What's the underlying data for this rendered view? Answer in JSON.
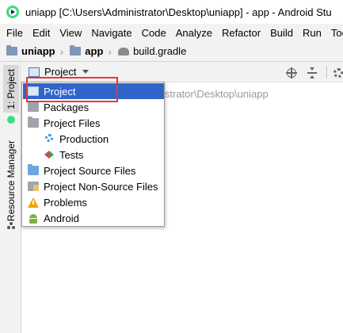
{
  "window": {
    "title": "uniapp [C:\\Users\\Administrator\\Desktop\\uniapp] - app - Android Stu"
  },
  "menubar": {
    "items": [
      "File",
      "Edit",
      "View",
      "Navigate",
      "Code",
      "Analyze",
      "Refactor",
      "Build",
      "Run",
      "Too"
    ]
  },
  "navbar": {
    "project": "uniapp",
    "module": "app",
    "file": "build.gradle"
  },
  "left_strip": {
    "project_tab": "1: Project",
    "resource_tab": "Resource Manager"
  },
  "project_view": {
    "selected_view": "Project",
    "path_partial": "istrator\\Desktop\\uniapp"
  },
  "view_menu": {
    "options": [
      {
        "label": "Project",
        "icon": "project-view-icon",
        "selected": true
      },
      {
        "label": "Packages",
        "icon": "folder-icon"
      },
      {
        "label": "Project Files",
        "icon": "folder-icon"
      },
      {
        "label": "Production",
        "icon": "gear-icon",
        "indent": true
      },
      {
        "label": "Tests",
        "icon": "test-icon",
        "indent": true
      },
      {
        "label": "Project Source Files",
        "icon": "source-folder-icon"
      },
      {
        "label": "Project Non-Source Files",
        "icon": "non-source-folder-icon"
      },
      {
        "label": "Problems",
        "icon": "warning-icon"
      },
      {
        "label": "Android",
        "icon": "android-icon"
      }
    ]
  },
  "colors": {
    "selection": "#2f65ca",
    "annotation": "#e53935"
  }
}
